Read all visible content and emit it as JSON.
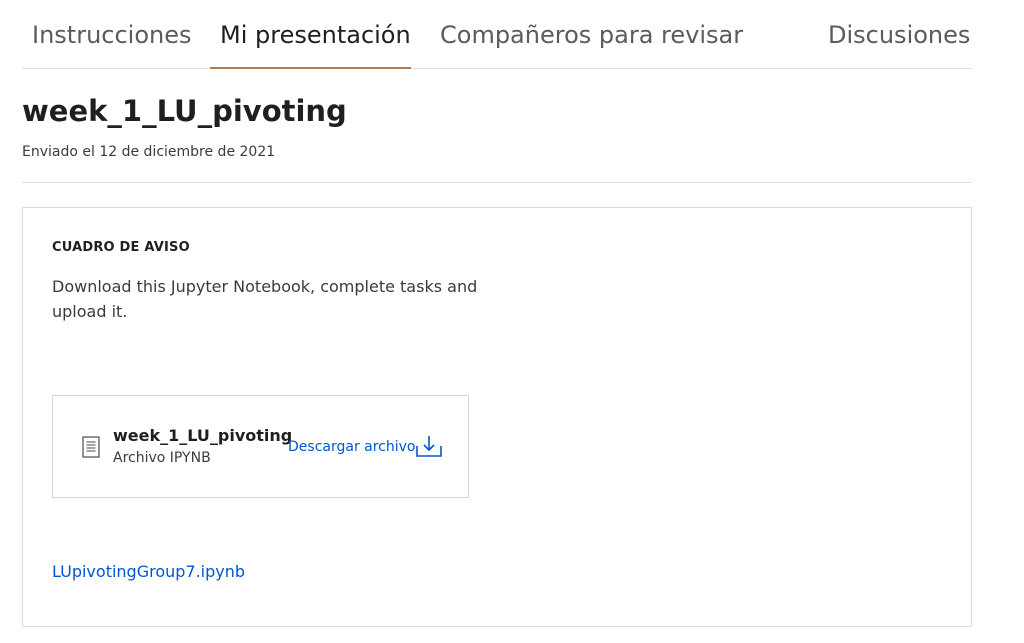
{
  "tabs": [
    {
      "label": "Instrucciones",
      "active": false
    },
    {
      "label": "Mi presentación",
      "active": true
    },
    {
      "label": "Compañeros para revisar",
      "active": false
    },
    {
      "label": "Discusiones",
      "active": false
    }
  ],
  "submission": {
    "title": "week_1_LU_pivoting",
    "submitted_text": "Enviado el 12 de diciembre de 2021"
  },
  "notice": {
    "heading": "CUADRO DE AVISO",
    "text": "Download this Jupyter Notebook, complete tasks and upload it.",
    "file": {
      "icon": "document-icon",
      "name": "week_1_LU_pivoting",
      "type": "Archivo IPYNB",
      "download_label": "Descargar archivo",
      "download_icon": "download-icon"
    },
    "uploaded_file_link": "LUpivotingGroup7.ipynb"
  },
  "colors": {
    "accent_underline": "#b27d46",
    "link": "#0056d2",
    "border": "#dcdcdc"
  }
}
